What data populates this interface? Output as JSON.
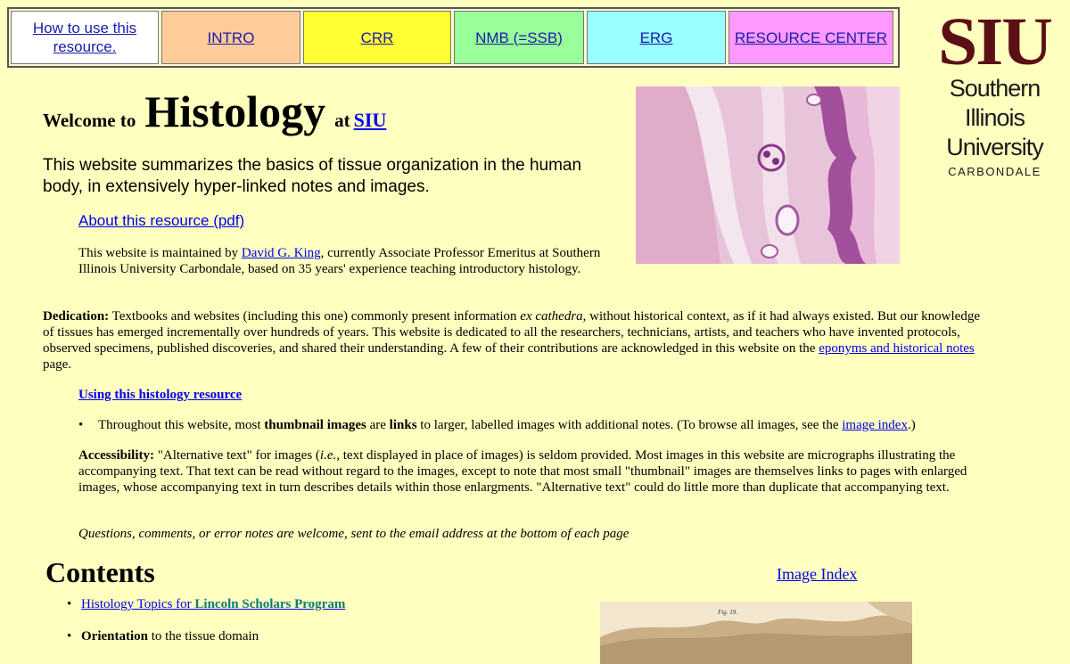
{
  "nav": {
    "items": [
      {
        "label": "How to use this resource.",
        "bg": "#ffffff"
      },
      {
        "label": "INTRO",
        "bg": "#ffcc99"
      },
      {
        "label": "CRR",
        "bg": "#ffff33"
      },
      {
        "label": "NMB (=SSB)",
        "bg": "#99ff99"
      },
      {
        "label": "ERG",
        "bg": "#99ffff"
      },
      {
        "label": "RESOURCE CENTER",
        "bg": "#ff99ff"
      }
    ]
  },
  "logo": {
    "mark": "SIU",
    "line1": "Southern",
    "line2": "Illinois",
    "line3": "University",
    "campus": "CARBONDALE"
  },
  "title": {
    "welcome": "Welcome to",
    "histology": "Histology",
    "at": "at",
    "siu_link": "SIU"
  },
  "intro_text": "This website summarizes the basics of tissue organization in the human body, in extensively hyper-linked notes and images.",
  "about_link": "About this resource (pdf)",
  "maintainer": {
    "prefix": "This website is maintained by ",
    "name": "David G. King",
    "suffix": ", currently Associate Professor Emeritus at Southern Illinois University Carbondale, based on 35 years' experience teaching introductory histology."
  },
  "dedication": {
    "label": "Dedication:",
    "text1": "  Textbooks and websites (including this one) commonly present information ",
    "italic": "ex cathedra",
    "text2": ", without historical context, as if it had always existed.  But our knowledge of tissues has emerged incrementally over hundreds of years.  This website is dedicated to all the researchers, technicians, artists, and teachers who have invented protocols, observed specimens, published discoveries, and shared their understanding.  A few of their contributions are acknowledged in this website on the ",
    "link": "eponyms and historical notes",
    "text3": " page."
  },
  "using_link": "Using this histology resource",
  "thumb_bullet": {
    "t1": "Throughout this website, most ",
    "b1": "thumbnail images",
    "t2": " are ",
    "b2": "links",
    "t3": " to larger, labelled images with additional notes.  (To browse all images, see the ",
    "link": "image index",
    "t4": ".)"
  },
  "accessibility": {
    "label": "Accessibility:",
    "t1": "  \"Alternative text\" for images (",
    "ie": "i.e.",
    "t2": ", text displayed in place of images) is seldom provided.  Most images in this website are micrographs illustrating the accompanying text.  That text can be read without regard to the images, except to note that most small \"thumbnail\" images are themselves links to pages with enlarged images, whose accompanying text in turn describes details within those enlargments.  \"Alternative text\" could do little more than duplicate that accompanying text."
  },
  "questions": "Questions, comments, or error notes are welcome, sent to the email address at the bottom of each page",
  "contents": {
    "heading": "Contents",
    "image_index": "Image Index",
    "item1_prefix": "Histology Topics for ",
    "item1_link": "Lincoln Scholars Program",
    "item2_bold": "Orientation",
    "item2_rest": " to the tissue domain"
  },
  "sketch_label": "Fig. 19."
}
